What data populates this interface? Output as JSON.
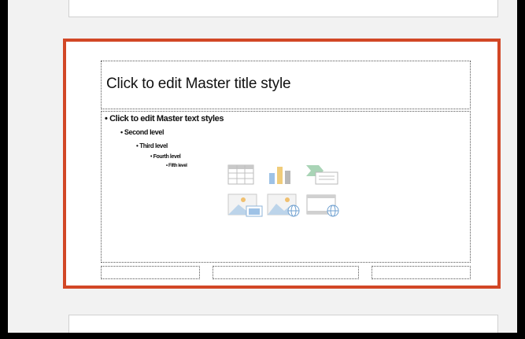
{
  "slide": {
    "title_placeholder": "Click to edit Master title style",
    "body_levels": [
      "Click to edit Master text styles",
      "Second level",
      "Third level",
      "Fourth level",
      "Fifth level"
    ],
    "footer": {
      "date": "",
      "center": "",
      "number": ""
    }
  },
  "content_icons": [
    "insert-table-icon",
    "insert-chart-icon",
    "insert-smartart-icon",
    "insert-picture-icon",
    "insert-online-picture-icon",
    "insert-video-icon"
  ],
  "colors": {
    "selection_border": "#d24726",
    "pane_background": "#f2f2f2"
  }
}
